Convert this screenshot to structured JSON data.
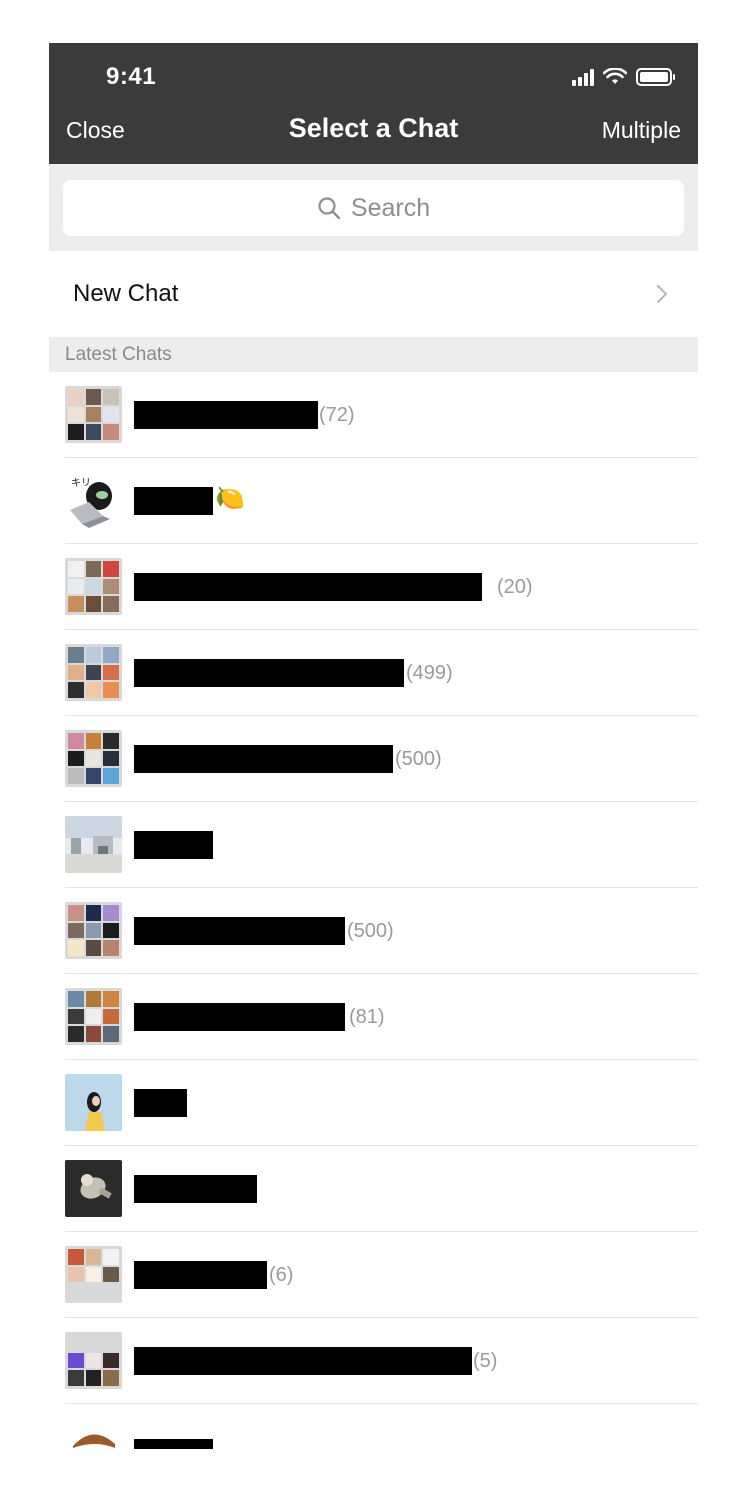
{
  "status_bar": {
    "time": "9:41"
  },
  "header": {
    "close_label": "Close",
    "title": "Select a Chat",
    "multiple_label": "Multiple"
  },
  "search": {
    "placeholder": "Search"
  },
  "new_chat": {
    "label": "New Chat"
  },
  "section": {
    "title": "Latest Chats"
  },
  "chats": [
    {
      "count": "(72)"
    },
    {
      "count": "🍋"
    },
    {
      "count": "(20)"
    },
    {
      "count": "(499)"
    },
    {
      "count": "(500)"
    },
    {
      "count": ""
    },
    {
      "count": "(500)"
    },
    {
      "count": "(81)"
    },
    {
      "count": ""
    },
    {
      "count": ""
    },
    {
      "count": "(6)"
    },
    {
      "count": "(5)"
    },
    {
      "count": ""
    }
  ],
  "colors": {
    "header_bg": "#3b3b3b",
    "section_bg": "#ededed",
    "secondary_text": "#9a9a9a"
  }
}
